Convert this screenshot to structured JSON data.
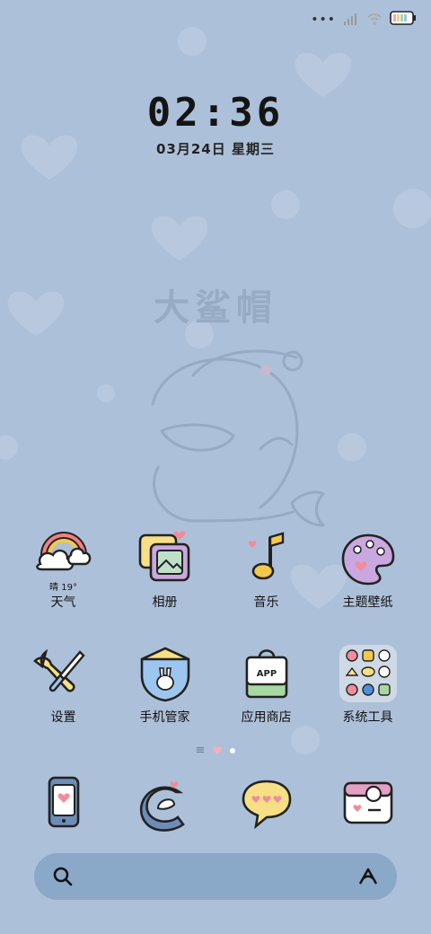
{
  "status": {
    "signal_dots": "•••"
  },
  "clock": {
    "time": "02:36",
    "date": "03月24日 星期三"
  },
  "wallpaper": {
    "brand_text": "大鲨帽"
  },
  "weather": {
    "summary": "晴 19°"
  },
  "apps_row1": [
    {
      "label": "天气",
      "icon": "weather-icon"
    },
    {
      "label": "相册",
      "icon": "gallery-icon"
    },
    {
      "label": "音乐",
      "icon": "music-note-icon"
    },
    {
      "label": "主题壁纸",
      "icon": "palette-icon"
    }
  ],
  "apps_row2": [
    {
      "label": "设置",
      "icon": "wrench-screwdriver-icon"
    },
    {
      "label": "手机管家",
      "icon": "shield-bunny-icon"
    },
    {
      "label": "应用商店",
      "icon": "shopping-bag-icon"
    },
    {
      "label": "系统工具",
      "icon": "folder-icon"
    }
  ],
  "pager": {
    "menu_glyph": "≡"
  },
  "dock": [
    {
      "icon": "phone-device-icon"
    },
    {
      "icon": "swirl-browser-icon"
    },
    {
      "icon": "chat-bubble-icon"
    },
    {
      "icon": "camera-icon"
    }
  ],
  "colors": {
    "background": "#adc0d9",
    "search_bar": "#8aa8c8",
    "accent_pink": "#f0a0ad"
  }
}
